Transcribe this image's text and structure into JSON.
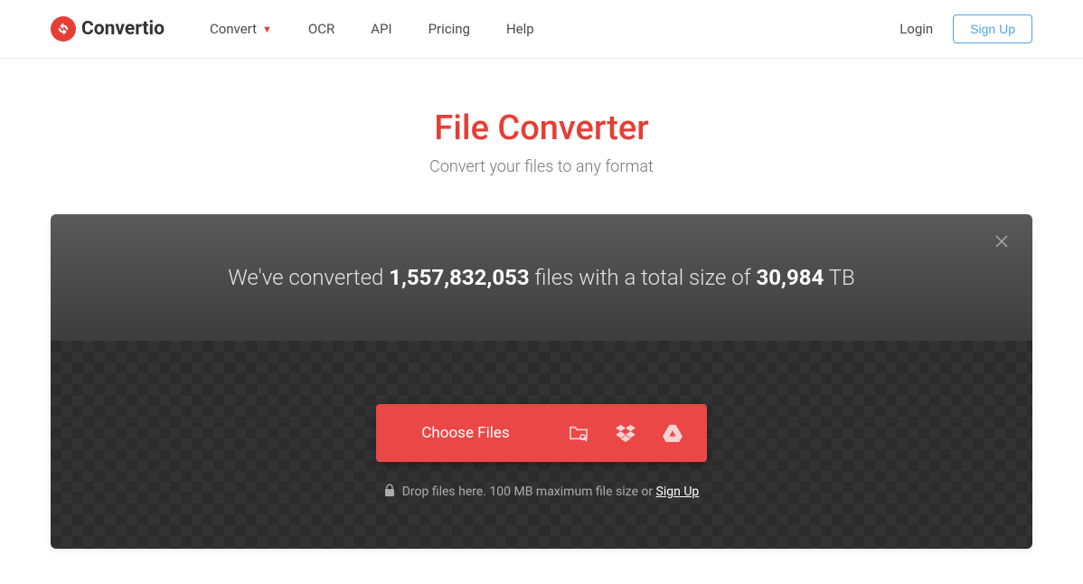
{
  "brand": {
    "name": "Convertio"
  },
  "nav": {
    "convert": "Convert",
    "ocr": "OCR",
    "api": "API",
    "pricing": "Pricing",
    "help": "Help"
  },
  "auth": {
    "login": "Login",
    "signup": "Sign Up"
  },
  "hero": {
    "title": "File Converter",
    "subtitle": "Convert your files to any format"
  },
  "stats": {
    "prefix": "We've converted ",
    "count": "1,557,832,053",
    "middle": " files with a total size of ",
    "size": "30,984",
    "suffix": " TB"
  },
  "upload": {
    "choose": "Choose Files",
    "hint_prefix": "Drop files here. 100 MB maximum file size or ",
    "hint_link": "Sign Up"
  }
}
